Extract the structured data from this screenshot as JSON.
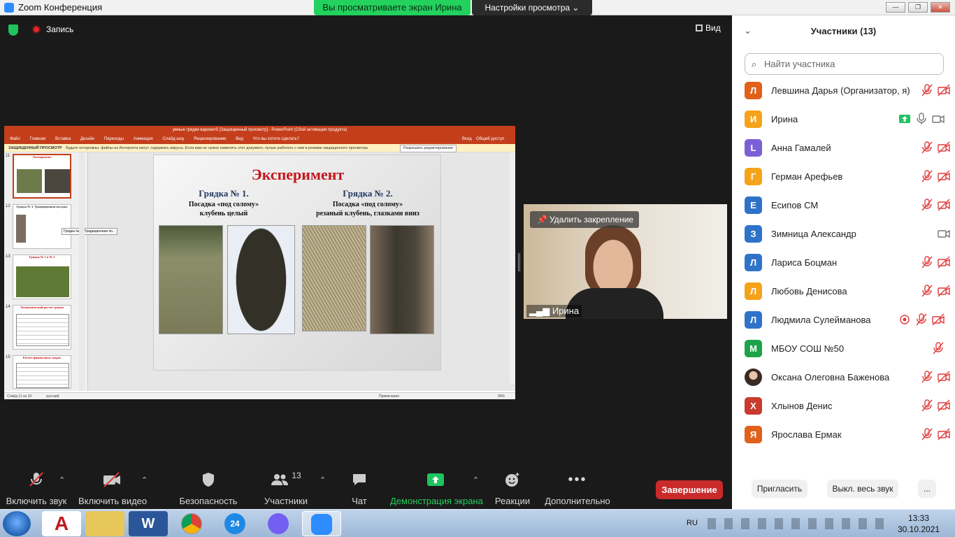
{
  "window": {
    "title": "Zoom Конференция",
    "viewing_banner": "Вы просматриваете экран Ирина",
    "view_options": "Настройки просмотра",
    "win_buttons": [
      "—",
      "❐",
      "✕"
    ]
  },
  "topbar": {
    "record": "Запись",
    "view": "Вид"
  },
  "ppt": {
    "title": "умные грядки вариант5 [Защищенный просмотр] - PowerPoint (Сбой активации продукта)",
    "menu": [
      "Файл",
      "Главная",
      "Вставка",
      "Дизайн",
      "Переходы",
      "Анимация",
      "Слайд-шоу",
      "Рецензирование",
      "Вид",
      "Что вы хотите сделать?"
    ],
    "right_menu": [
      "Вход",
      "Общий доступ"
    ],
    "protected_label": "ЗАЩИЩЕННЫЙ ПРОСМОТР",
    "protected_text": "Будьте осторожны: файлы из Интернета могут содержать вирусы. Если вам не нужно изменять этот документ, лучше работать с ним в режиме защищенного просмотра.",
    "enable_editing": "Разрешить редактирование",
    "thumbs": [
      {
        "num": "11",
        "title": "Эксперимент"
      },
      {
        "num": "12",
        "title": "Грядка № 3. Традиционная посадка"
      },
      {
        "num": "13",
        "title": "Грядки № 1 и № 2"
      },
      {
        "num": "14",
        "title": "Экономический расчет грядок"
      },
      {
        "num": "15",
        "title": "Расчет финансовых затрат"
      }
    ],
    "tooltip": "Грядка № 3. Традиционная по...",
    "slide": {
      "title": "Эксперимент",
      "left_heading": "Грядка № 1.",
      "left_sub1": "Посадка «под солому»",
      "left_sub2": "клубень целый",
      "right_heading": "Грядка № 2.",
      "right_sub1": "Посадка «под солому»",
      "right_sub2": "резаный клубень, глазками вниз"
    },
    "status_left": "Слайд 11 из 19",
    "status_lang": "русский",
    "status_notes": "Примечания",
    "status_zoom": "90%"
  },
  "video": {
    "unpin": "Удалить закрепление",
    "name": "Ирина"
  },
  "toolbar": {
    "mute": "Включить звук",
    "video": "Включить видео",
    "security": "Безопасность",
    "participants": "Участники",
    "participants_count": "13",
    "chat": "Чат",
    "share": "Демонстрация экрана",
    "reactions": "Реакции",
    "more": "Дополнительно",
    "end": "Завершение"
  },
  "panel": {
    "title": "Участники (13)",
    "search_placeholder": "Найти участника",
    "participants": [
      {
        "initial": "Л",
        "name": "Левшина Дарья (Организатор, я)",
        "color": "#e0611a"
      },
      {
        "initial": "И",
        "name": "Ирина",
        "color": "#f5a31a"
      },
      {
        "initial": "L",
        "name": "Анна Гамалей",
        "color": "#7b5fd6"
      },
      {
        "initial": "Г",
        "name": "Герман Арефьев",
        "color": "#f5a31a"
      },
      {
        "initial": "Е",
        "name": "Есипов СМ",
        "color": "#2f73c9"
      },
      {
        "initial": "З",
        "name": "Зимница Александр",
        "color": "#2f73c9"
      },
      {
        "initial": "Л",
        "name": "Лариса Боцман",
        "color": "#2f73c9"
      },
      {
        "initial": "Л",
        "name": "Любовь Денисова",
        "color": "#f5a31a"
      },
      {
        "initial": "Л",
        "name": "Людмила Сулейманова",
        "color": "#2f73c9"
      },
      {
        "initial": "М",
        "name": "МБОУ СОШ №50",
        "color": "#1fa34a"
      },
      {
        "initial": "",
        "name": "Оксана Олеговна Баженова",
        "color": "#8a6a5a"
      },
      {
        "initial": "Х",
        "name": "Хлынов Денис",
        "color": "#c93b2e"
      },
      {
        "initial": "Я",
        "name": "Ярослава Ермак",
        "color": "#e0611a"
      }
    ],
    "invite": "Пригласить",
    "mute_all": "Выкл. весь звук",
    "more": "..."
  },
  "taskbar": {
    "lang": "RU",
    "time": "13:33",
    "date": "30.10.2021"
  }
}
